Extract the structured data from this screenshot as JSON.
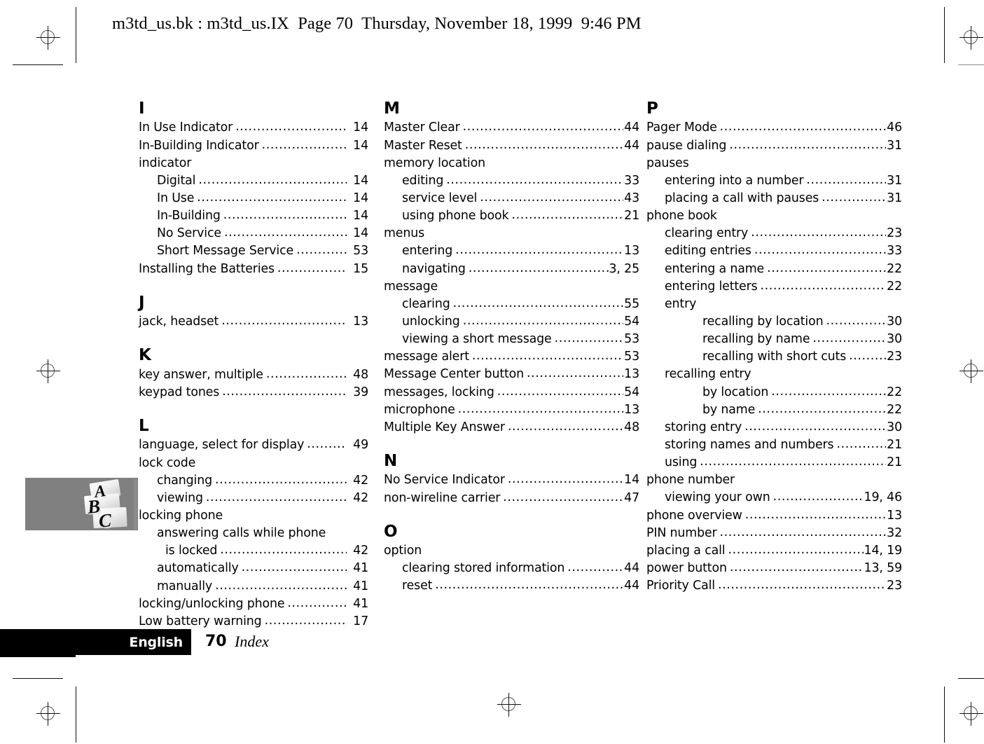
{
  "header": {
    "file_info": "m3td_us.bk : m3td_us.IX  Page 70  Thursday, November 18, 1999  9:46 PM"
  },
  "footer": {
    "language": "English",
    "page_number": "70",
    "section": "Index"
  },
  "graphic": {
    "name": "abc-letters-graphic",
    "letters": [
      "A",
      "B",
      "C"
    ],
    "background_color": "#808080"
  },
  "columns": [
    {
      "id": "column-1",
      "groups": [
        {
          "letter": "I",
          "entries": [
            {
              "label": "In Use Indicator",
              "page": "14",
              "level": 0,
              "dots": true
            },
            {
              "label": "In-Building Indicator",
              "page": "14",
              "level": 0,
              "dots": true
            },
            {
              "label": "indicator",
              "page": "",
              "level": 0,
              "dots": false
            },
            {
              "label": "Digital",
              "page": "14",
              "level": 1,
              "dots": true
            },
            {
              "label": "In Use",
              "page": "14",
              "level": 1,
              "dots": true
            },
            {
              "label": "In-Building",
              "page": "14",
              "level": 1,
              "dots": true
            },
            {
              "label": "No Service",
              "page": "14",
              "level": 1,
              "dots": true
            },
            {
              "label": "Short Message Service",
              "page": "53",
              "level": 1,
              "dots": true
            },
            {
              "label": "Installing the Batteries",
              "page": "15",
              "level": 0,
              "dots": true
            }
          ]
        },
        {
          "letter": "J",
          "entries": [
            {
              "label": "jack, headset",
              "page": "13",
              "level": 0,
              "dots": true
            }
          ]
        },
        {
          "letter": "K",
          "entries": [
            {
              "label": "key answer, multiple",
              "page": "48",
              "level": 0,
              "dots": true
            },
            {
              "label": "keypad tones",
              "page": "39",
              "level": 0,
              "dots": true
            }
          ]
        },
        {
          "letter": "L",
          "entries": [
            {
              "label": "language, select for display",
              "page": "49",
              "level": 0,
              "dots": true
            },
            {
              "label": "lock code",
              "page": "",
              "level": 0,
              "dots": false
            },
            {
              "label": "changing",
              "page": "42",
              "level": 1,
              "dots": true
            },
            {
              "label": "viewing",
              "page": "42",
              "level": 1,
              "dots": true
            },
            {
              "label": "locking phone",
              "page": "",
              "level": 0,
              "dots": false
            },
            {
              "label": "answering calls while phone",
              "page": "",
              "level": 1,
              "dots": false
            },
            {
              "label": "is locked",
              "page": "42",
              "level": 2,
              "dots": true
            },
            {
              "label": "automatically",
              "page": "41",
              "level": 1,
              "dots": true
            },
            {
              "label": "manually",
              "page": "41",
              "level": 1,
              "dots": true
            },
            {
              "label": "locking/unlocking phone",
              "page": "41",
              "level": 0,
              "dots": true
            },
            {
              "label": "Low battery warning",
              "page": "17",
              "level": 0,
              "dots": true
            }
          ]
        }
      ]
    },
    {
      "id": "column-2",
      "groups": [
        {
          "letter": "M",
          "entries": [
            {
              "label": "Master Clear",
              "page": "44",
              "level": 0,
              "dots": true
            },
            {
              "label": "Master Reset",
              "page": "44",
              "level": 0,
              "dots": true
            },
            {
              "label": "memory location",
              "page": "",
              "level": 0,
              "dots": false
            },
            {
              "label": "editing",
              "page": "33",
              "level": 1,
              "dots": true
            },
            {
              "label": "service level",
              "page": "43",
              "level": 1,
              "dots": true
            },
            {
              "label": "using phone book",
              "page": "21",
              "level": 1,
              "dots": true
            },
            {
              "label": "menus",
              "page": "",
              "level": 0,
              "dots": false
            },
            {
              "label": "entering",
              "page": "13",
              "level": 1,
              "dots": true
            },
            {
              "label": "navigating",
              "page": "3, 25",
              "level": 1,
              "dots": true
            },
            {
              "label": "message",
              "page": "",
              "level": 0,
              "dots": false
            },
            {
              "label": "clearing",
              "page": "55",
              "level": 1,
              "dots": true
            },
            {
              "label": "unlocking",
              "page": "54",
              "level": 1,
              "dots": true
            },
            {
              "label": "viewing a short message",
              "page": "53",
              "level": 1,
              "dots": true
            },
            {
              "label": "message alert",
              "page": "53",
              "level": 0,
              "dots": true
            },
            {
              "label": "Message Center button",
              "page": "13",
              "level": 0,
              "dots": true
            },
            {
              "label": "messages, locking",
              "page": "54",
              "level": 0,
              "dots": true
            },
            {
              "label": "microphone",
              "page": "13",
              "level": 0,
              "dots": true
            },
            {
              "label": "Multiple Key Answer",
              "page": "48",
              "level": 0,
              "dots": true
            }
          ]
        },
        {
          "letter": "N",
          "entries": [
            {
              "label": "No Service Indicator",
              "page": "14",
              "level": 0,
              "dots": true
            },
            {
              "label": "non-wireline carrier",
              "page": "47",
              "level": 0,
              "dots": true
            }
          ]
        },
        {
          "letter": "O",
          "entries": [
            {
              "label": "option",
              "page": "",
              "level": 0,
              "dots": false
            },
            {
              "label": "clearing stored information",
              "page": "44",
              "level": 1,
              "dots": true
            },
            {
              "label": "reset",
              "page": "44",
              "level": 1,
              "dots": true
            }
          ]
        }
      ]
    },
    {
      "id": "column-3",
      "groups": [
        {
          "letter": "P",
          "entries": [
            {
              "label": "Pager Mode",
              "page": "46",
              "level": 0,
              "dots": true
            },
            {
              "label": "pause dialing",
              "page": "31",
              "level": 0,
              "dots": true
            },
            {
              "label": "pauses",
              "page": "",
              "level": 0,
              "dots": false
            },
            {
              "label": "entering into a number",
              "page": "31",
              "level": 1,
              "dots": true
            },
            {
              "label": "placing a call with pauses",
              "page": "31",
              "level": 1,
              "dots": true
            },
            {
              "label": "phone book",
              "page": "",
              "level": 0,
              "dots": false
            },
            {
              "label": "clearing entry",
              "page": "23",
              "level": 1,
              "dots": true
            },
            {
              "label": "editing entries",
              "page": "33",
              "level": 1,
              "dots": true
            },
            {
              "label": "entering a name",
              "page": "22",
              "level": 1,
              "dots": true
            },
            {
              "label": "entering letters",
              "page": "22",
              "level": 1,
              "dots": true
            },
            {
              "label": "entry",
              "page": "",
              "level": 1,
              "dots": false
            },
            {
              "label": "recalling by location",
              "page": "30",
              "level": 3,
              "dots": true
            },
            {
              "label": "recalling by name",
              "page": "30",
              "level": 3,
              "dots": true
            },
            {
              "label": "recalling with short cuts",
              "page": "23",
              "level": 3,
              "dots": true
            },
            {
              "label": "recalling entry",
              "page": "",
              "level": 1,
              "dots": false
            },
            {
              "label": "by location",
              "page": "22",
              "level": 3,
              "dots": true
            },
            {
              "label": "by name",
              "page": "22",
              "level": 3,
              "dots": true
            },
            {
              "label": "storing entry",
              "page": "30",
              "level": 1,
              "dots": true
            },
            {
              "label": "storing names and numbers",
              "page": "21",
              "level": 1,
              "dots": true
            },
            {
              "label": "using",
              "page": "21",
              "level": 1,
              "dots": true
            },
            {
              "label": "phone number",
              "page": "",
              "level": 0,
              "dots": false
            },
            {
              "label": "viewing your own",
              "page": "19, 46",
              "level": 1,
              "dots": true
            },
            {
              "label": "phone overview",
              "page": "13",
              "level": 0,
              "dots": true
            },
            {
              "label": "PIN number",
              "page": "32",
              "level": 0,
              "dots": true
            },
            {
              "label": "placing a call",
              "page": "14, 19",
              "level": 0,
              "dots": true
            },
            {
              "label": "power button",
              "page": "13, 59",
              "level": 0,
              "dots": true
            },
            {
              "label": "Priority Call",
              "page": "23",
              "level": 0,
              "dots": true
            }
          ]
        }
      ]
    }
  ]
}
